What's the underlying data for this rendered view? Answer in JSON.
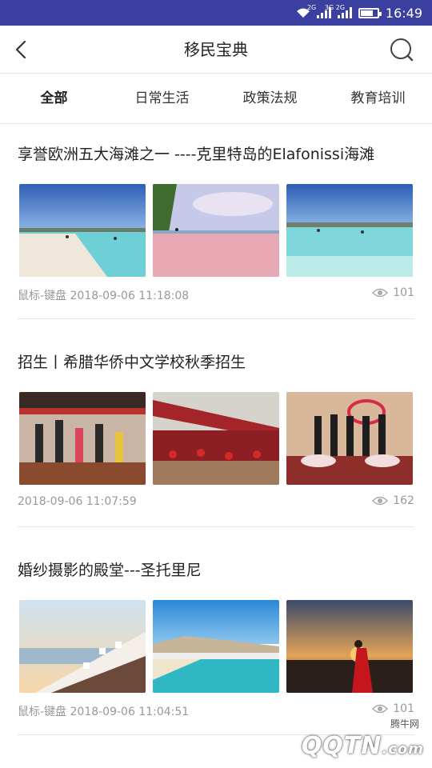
{
  "status": {
    "time": "16:49",
    "net1": "2G",
    "net2": "3G 2G"
  },
  "header": {
    "title": "移民宝典"
  },
  "tabs": [
    {
      "label": "全部",
      "active": true
    },
    {
      "label": "日常生活",
      "active": false
    },
    {
      "label": "政策法规",
      "active": false
    },
    {
      "label": "教育培训",
      "active": false
    }
  ],
  "articles": [
    {
      "title": "享誉欧洲五大海滩之一 ----克里特岛的Elafonissi海滩",
      "meta": "鼠标-键盘 2018-09-06 11:18:08",
      "views": "101"
    },
    {
      "title": "招生丨希腊华侨中文学校秋季招生",
      "meta": "2018-09-06 11:07:59",
      "views": "162"
    },
    {
      "title": "婚纱摄影的殿堂---圣托里尼",
      "meta": "鼠标-键盘 2018-09-06 11:04:51",
      "views": "101"
    }
  ],
  "watermark": {
    "logo": "QQTN",
    "suffix": ".com",
    "small": "腾牛网"
  },
  "colors": {
    "statusbar": "#3a3fa0",
    "tab_highlight": "#f5d76e"
  }
}
